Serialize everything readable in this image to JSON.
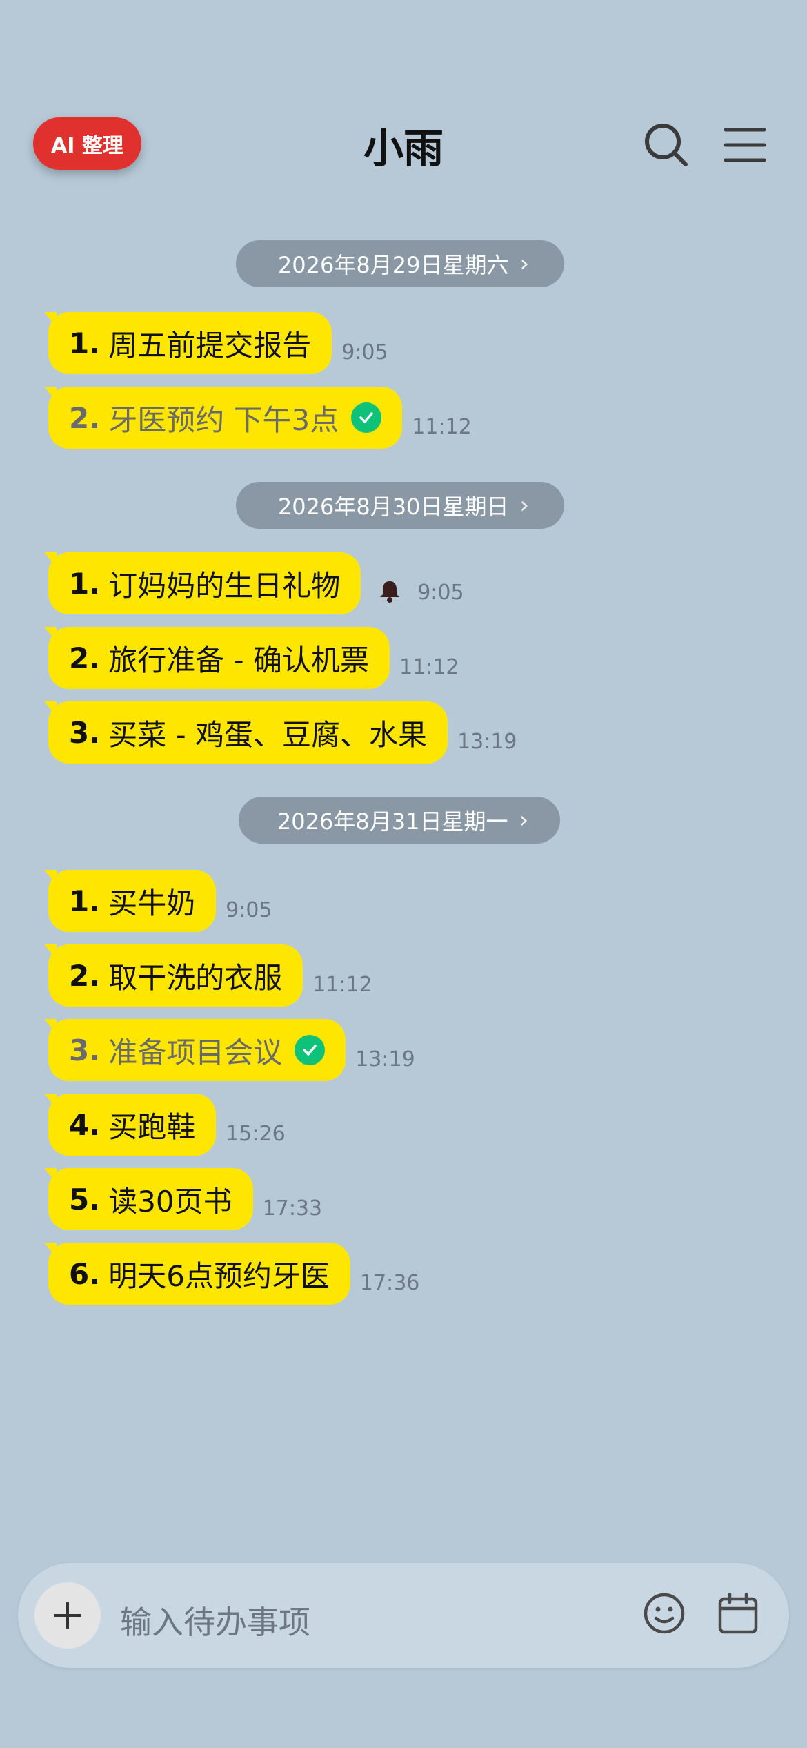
{
  "header": {
    "ai_button": "AI 整理",
    "title": "小雨",
    "icons": [
      "search-icon",
      "menu-icon"
    ]
  },
  "sections": [
    {
      "date": "2026年8月29日星期六",
      "items": [
        {
          "num": "1.",
          "text": "周五前提交报告",
          "time": "9:05",
          "done": false
        },
        {
          "num": "2.",
          "text": "牙医预约 下午3点",
          "time": "11:12",
          "done": true
        }
      ]
    },
    {
      "date": "2026年8月30日星期日",
      "items": [
        {
          "num": "1.",
          "text": "订妈妈的生日礼物",
          "time": "9:05",
          "done": false,
          "reminder": true
        },
        {
          "num": "2.",
          "text": "旅行准备 - 确认机票",
          "time": "11:12",
          "done": false
        },
        {
          "num": "3.",
          "text": "买菜 - 鸡蛋、豆腐、水果",
          "time": "13:19",
          "done": false
        }
      ]
    },
    {
      "date": "2026年8月31日星期一",
      "items": [
        {
          "num": "1.",
          "text": "买牛奶",
          "time": "9:05",
          "done": false
        },
        {
          "num": "2.",
          "text": "取干洗的衣服",
          "time": "11:12",
          "done": false
        },
        {
          "num": "3.",
          "text": "准备项目会议",
          "time": "13:19",
          "done": true
        },
        {
          "num": "4.",
          "text": "买跑鞋",
          "time": "15:26",
          "done": false
        },
        {
          "num": "5.",
          "text": "读30页书",
          "time": "17:33",
          "done": false
        },
        {
          "num": "6.",
          "text": "明天6点预约牙医",
          "time": "17:36",
          "done": false
        }
      ]
    }
  ],
  "input": {
    "placeholder": "输入待办事项",
    "icons": [
      "plus-icon",
      "emoji-icon",
      "calendar-icon"
    ]
  },
  "colors": {
    "background": "#b7c9d7",
    "bubble": "#ffe600",
    "ai_button": "#e0312f",
    "date_pill": "#8998a4",
    "check": "#0ec27a"
  }
}
